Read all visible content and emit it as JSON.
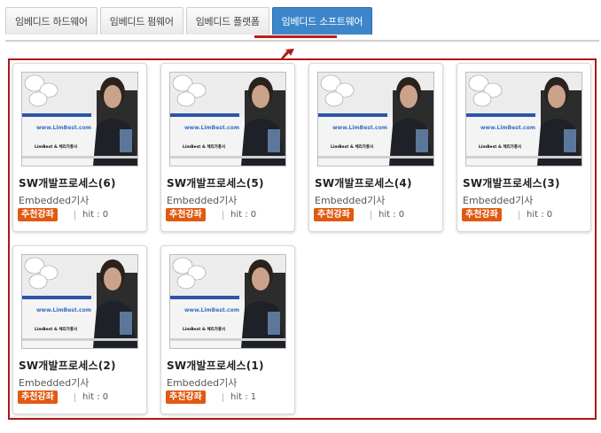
{
  "tabs": [
    {
      "label": "임베디드 하드웨어",
      "active": false
    },
    {
      "label": "임베디드 펌웨어",
      "active": false
    },
    {
      "label": "임베디드 플랫폼",
      "active": false
    },
    {
      "label": "임베디드 소프트웨어",
      "active": true
    }
  ],
  "colors": {
    "active_tab": "#3c86c9",
    "accent_red": "#b01818",
    "badge": "#e05a12"
  },
  "thumbnail": {
    "url_text": "www.LimBest.com",
    "caption": "LimBest & 체리가홍사"
  },
  "cards": [
    {
      "title": "SW개발프로세스(6)",
      "category": "Embedded기사",
      "badge": "추천강좌",
      "hit": "hit : 0"
    },
    {
      "title": "SW개발프로세스(5)",
      "category": "Embedded기사",
      "badge": "추천강좌",
      "hit": "hit : 0"
    },
    {
      "title": "SW개발프로세스(4)",
      "category": "Embedded기사",
      "badge": "추천강좌",
      "hit": "hit : 0"
    },
    {
      "title": "SW개발프로세스(3)",
      "category": "Embedded기사",
      "badge": "추천강좌",
      "hit": "hit : 0"
    },
    {
      "title": "SW개발프로세스(2)",
      "category": "Embedded기사",
      "badge": "추천강좌",
      "hit": "hit : 0"
    },
    {
      "title": "SW개발프로세스(1)",
      "category": "Embedded기사",
      "badge": "추천강좌",
      "hit": "hit : 1"
    }
  ]
}
